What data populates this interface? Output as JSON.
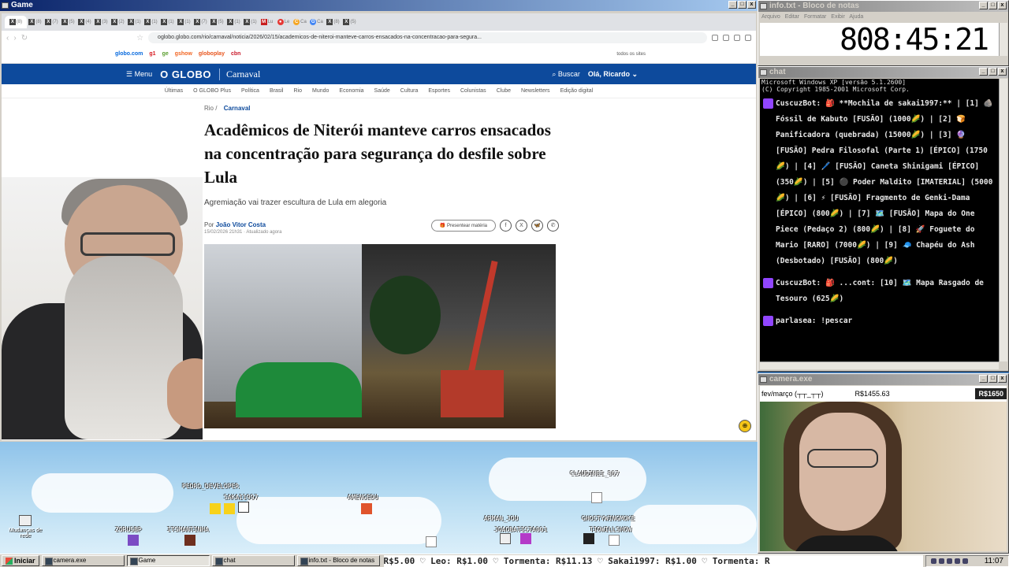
{
  "browser": {
    "window_title": "Game",
    "tabs": [
      {
        "icon": "X",
        "label": "(8)"
      },
      {
        "icon": "X",
        "label": "(8)"
      },
      {
        "icon": "X",
        "label": "(7)"
      },
      {
        "icon": "X",
        "label": "(5)"
      },
      {
        "icon": "X",
        "label": "(4)"
      },
      {
        "icon": "X",
        "label": "(3)"
      },
      {
        "icon": "X",
        "label": "(2)"
      },
      {
        "icon": "X",
        "label": "(1)"
      },
      {
        "icon": "X",
        "label": "(1)"
      },
      {
        "icon": "X",
        "label": "(1)"
      },
      {
        "icon": "X",
        "label": "(1)"
      },
      {
        "icon": "X",
        "label": "(7)"
      },
      {
        "icon": "X",
        "label": "(5)"
      },
      {
        "icon": "X",
        "label": "(1)"
      },
      {
        "icon": "X",
        "label": "(1)"
      },
      {
        "icon": "M",
        "label": "Lu"
      },
      {
        "icon": "●",
        "label": "Le"
      },
      {
        "icon": "C",
        "label": "Ca"
      },
      {
        "icon": "G",
        "label": "Ca"
      },
      {
        "icon": "X",
        "label": "(8)"
      },
      {
        "icon": "X",
        "label": "(5)"
      }
    ],
    "url": "oglobo.globo.com/rio/carnaval/noticia/2026/02/15/academicos-de-niteroi-manteve-carros-ensacados-na-concentracao-para-segura...",
    "bookmarks": [
      "globo.com",
      "g1",
      "ge",
      "gshow",
      "globoplay",
      "cbn"
    ],
    "bookmarks_all": "todos os sites"
  },
  "site": {
    "menu": "Menu",
    "logo": "O GLOBO",
    "section": "Carnaval",
    "search": "Buscar",
    "greeting": "Olá, Ricardo",
    "nav": [
      "Últimas",
      "O GLOBO Plus",
      "Política",
      "Brasil",
      "Rio",
      "Mundo",
      "Economia",
      "Saúde",
      "Cultura",
      "Esportes",
      "Colunistas",
      "Clube",
      "Newsletters",
      "Edição digital"
    ]
  },
  "article": {
    "crumb_root": "Rio",
    "crumb_sep": "/",
    "crumb_section": "Carnaval",
    "headline": "Acadêmicos de Niterói manteve carros ensacados na concentração para segurança do desfile sobre Lula",
    "subtitle": "Agremiação vai trazer escultura de Lula em alegoria",
    "by_prefix": "Por",
    "author": "João Vitor Costa",
    "date": "15/02/2026 21h31 · Atualizado agora",
    "gift": "Presentear matéria"
  },
  "game": {
    "players": [
      "PEDRO_DEVELOPER",
      "SAKAI1997",
      "ZORUSBP",
      "ITSMANTINHA",
      "AMENGEDU",
      "CLAUDINEI_867",
      "ARMAN_JOU",
      "JOAOBATISTA001",
      "GHOSTYWINGMOKE",
      "TIOWILLSHOW"
    ],
    "desktop_icon": "Mudanças de rede"
  },
  "notepad": {
    "title": "info.txt - Bloco de notas",
    "menu": [
      "Arquivo",
      "Editar",
      "Formatar",
      "Exibir",
      "Ajuda"
    ],
    "clock": "808:45:21"
  },
  "chat": {
    "title": "chat",
    "cmd_line1": "Microsoft Windows XP [versão 5.1.2600]",
    "cmd_line2": "(C) Copyright 1985-2001 Microsoft Corp.",
    "messages": [
      {
        "user": "CuscuzBot:",
        "text": "🎒 **Mochila de sakai1997:** | [1] 🪨 Fóssil de Kabuto [FUSÃO] (1000🌽) | [2] 🍞 Panificadora (quebrada) (15000🌽) | [3] 🔮 [FUSÃO] Pedra Filosofal (Parte 1) [ÉPICO] (1750🌽) | [4] 🖊️ [FUSÃO] Caneta Shinigami [ÉPICO] (350🌽) | [5] ⚫ Poder Maldito [IMATERIAL] (5000🌽) | [6] ⚡ [FUSÃO] Fragmento de Genki-Dama [ÉPICO] (800🌽) | [7] 🗺️ [FUSÃO] Mapa do One Piece (Pedaço 2) (800🌽) | [8] 🚀 Foguete do Mario [RARO] (7000🌽) | [9] 🧢 Chapéu do Ash (Desbotado) [FUSÃO] (800🌽)"
      },
      {
        "user": "CuscuzBot:",
        "text": "🎒 ...cont: [10] 🗺️ Mapa Rasgado de Tesouro (625🌽)"
      },
      {
        "user": "parlasea:",
        "text": "!pescar"
      }
    ]
  },
  "camera": {
    "title": "camera.exe",
    "label": "fev/março (┬┬_┬┬)",
    "amount": "R$1455.63",
    "total": "R$1650"
  },
  "taskbar": {
    "start": "Iniciar",
    "tasks": [
      "camera.exe",
      "Game",
      "chat",
      "info.txt - Bloco de notas"
    ],
    "ticker": "R$5.00 ♡ Leo: R$1.00 ♡ Tormenta: R$11.13 ♡ Sakai1997: R$1.00 ♡ Tormenta: R",
    "time": "11:07"
  }
}
